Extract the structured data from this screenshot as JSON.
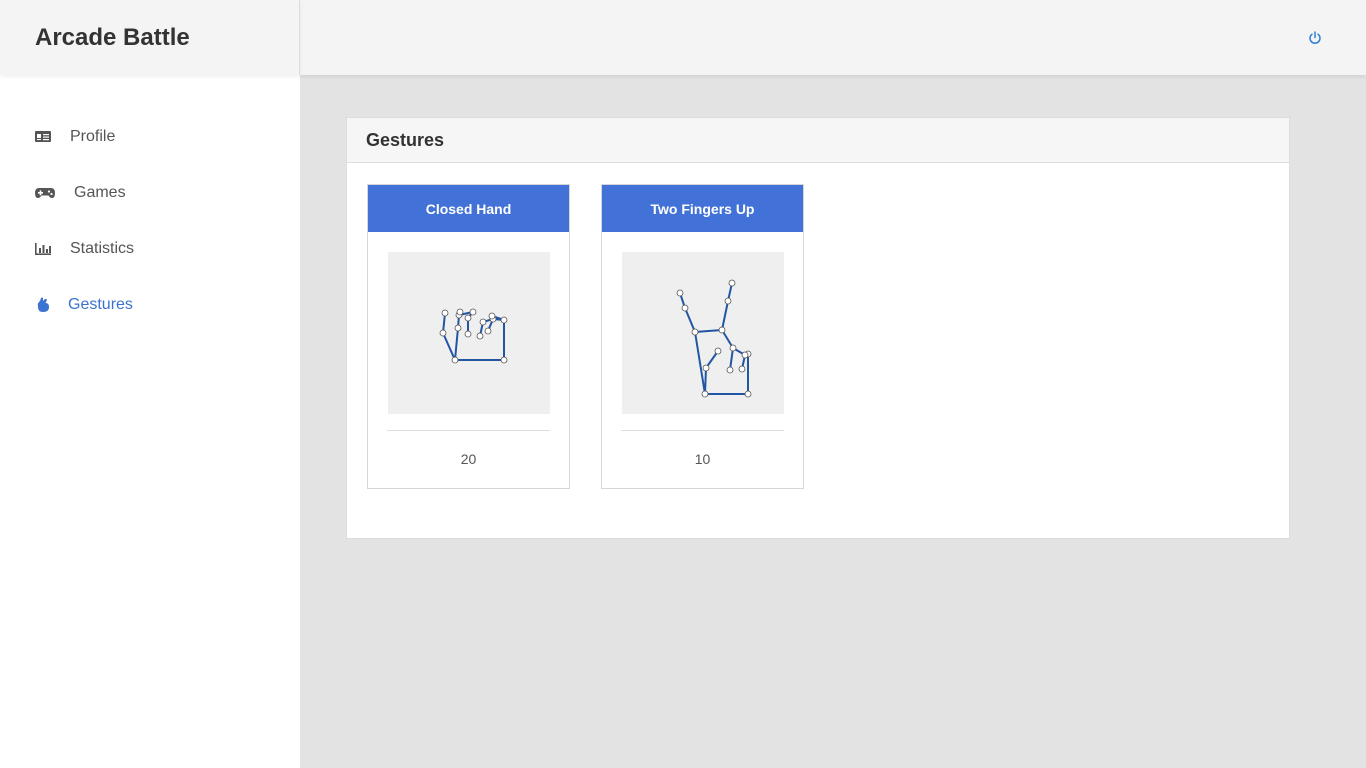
{
  "app": {
    "title": "Arcade Battle"
  },
  "header": {
    "power_icon": "power-icon"
  },
  "sidebar": {
    "items": [
      {
        "label": "Profile",
        "icon": "id-card-icon",
        "active": false
      },
      {
        "label": "Games",
        "icon": "gamepad-icon",
        "active": false
      },
      {
        "label": "Statistics",
        "icon": "bar-chart-icon",
        "active": false
      },
      {
        "label": "Gestures",
        "icon": "hand-icon",
        "active": true
      }
    ]
  },
  "panel": {
    "title": "Gestures"
  },
  "gestures": [
    {
      "name": "Closed Hand",
      "count": "20",
      "image": "hand-skeleton-closed"
    },
    {
      "name": "Two Fingers Up",
      "count": "10",
      "image": "hand-skeleton-two-fingers"
    }
  ],
  "colors": {
    "accent": "#4272d7",
    "active_nav": "#3a73d0",
    "skeleton_line": "#2255a4"
  }
}
